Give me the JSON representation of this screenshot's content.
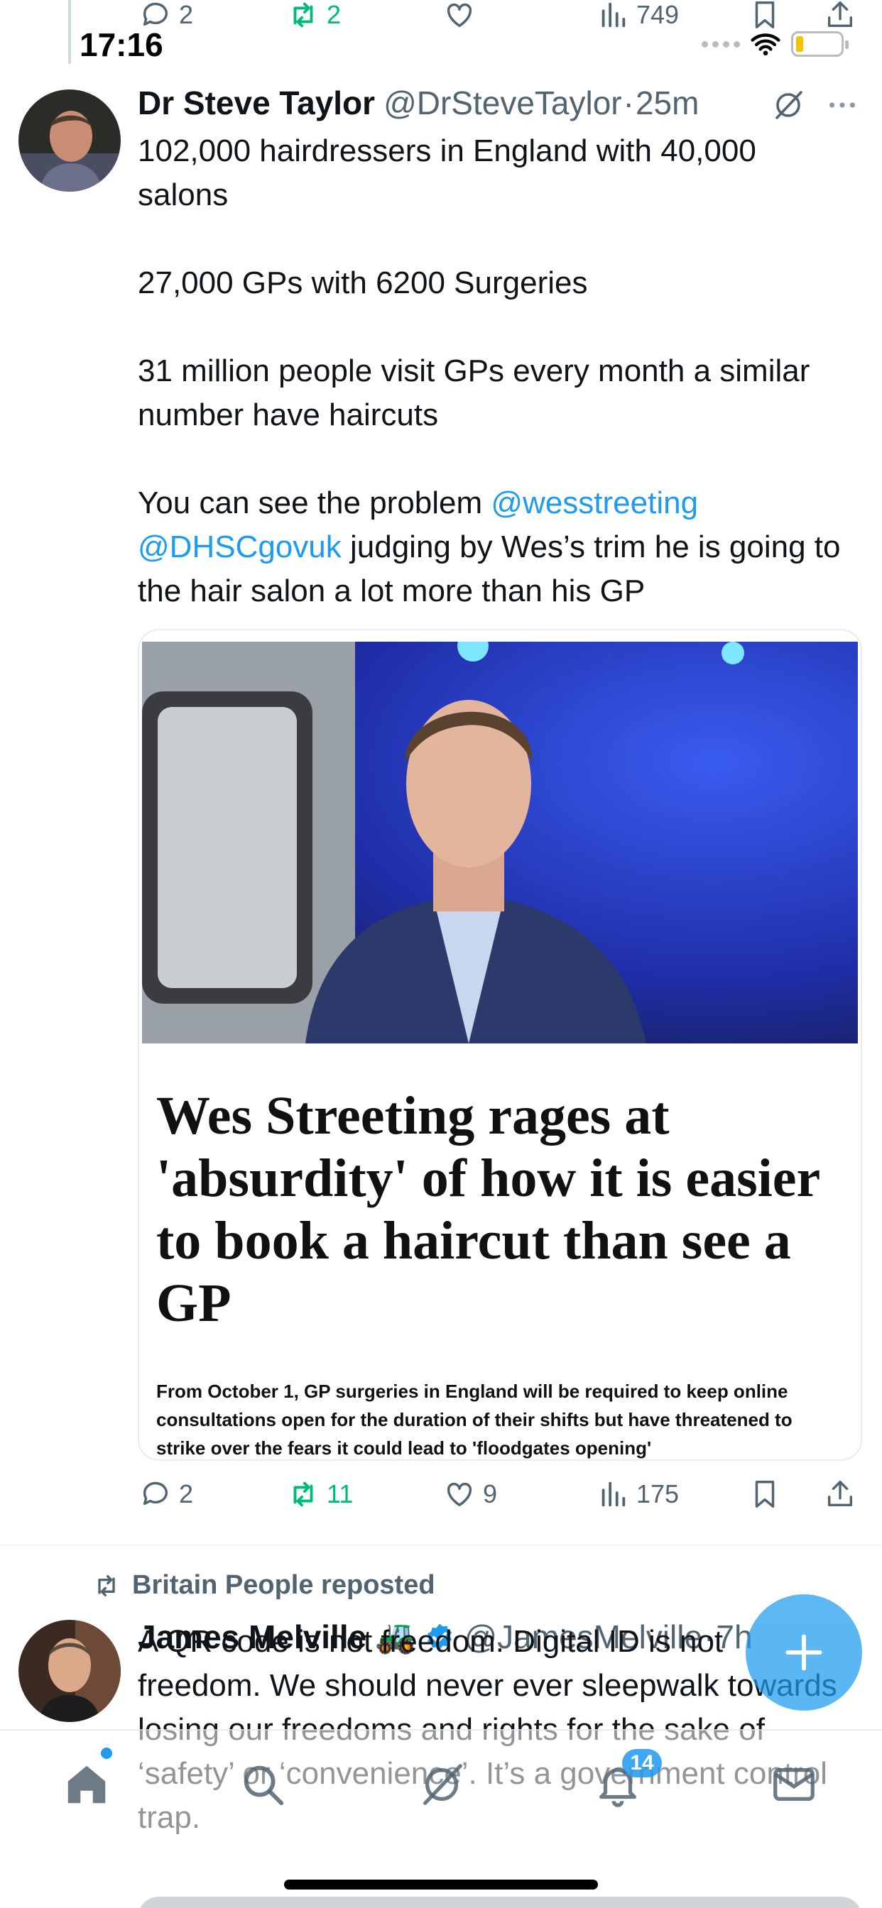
{
  "status_bar": {
    "time": "17:16"
  },
  "prev_tweet_actions": {
    "replies": "2",
    "reposts": "2",
    "views": "749"
  },
  "tweet1": {
    "author_name": "Dr Steve Taylor",
    "author_handle": "@DrSteveTaylor",
    "separator": "·",
    "time": "25m",
    "para1": "102,000 hairdressers in England with 40,000 salons",
    "para2": "27,000 GPs with 6200 Surgeries",
    "para3": "31 million people visit GPs every month a similar number have haircuts",
    "para4_pre": "You can see the problem ",
    "mention1": "@wesstreeting",
    "mention2": "@DHSCgovuk",
    "para4_post": " judging by Wes’s trim he is going to the hair salon a lot more than his GP",
    "card": {
      "headline": "Wes Streeting rages at 'absurdity' of how it is easier to book a haircut than see a GP",
      "standfirst": "From October 1, GP surgeries in England will be required to keep online consultations open for the duration of their shifts but have threatened to strike over the fears it could lead to 'floodgates opening'"
    },
    "actions": {
      "replies": "2",
      "reposts": "11",
      "likes": "9",
      "views": "175"
    }
  },
  "tweet2": {
    "repost_label": "Britain People reposted",
    "author_name": "James Melville",
    "emoji": "🚜",
    "author_handle": "@JamesMelville",
    "separator": "·",
    "time": "7h",
    "text": "A QR code is not freedom. Digital ID is not freedom. We should never ever sleepwalk towards losing our freedoms and rights for the sake of ‘safety’ or ‘convenience’. It’s a government control trap."
  },
  "tabbar": {
    "notifications_badge": "14"
  },
  "colors": {
    "accent": "#1d9bf0",
    "repost_green": "#00ba7c",
    "muted": "#536471"
  }
}
